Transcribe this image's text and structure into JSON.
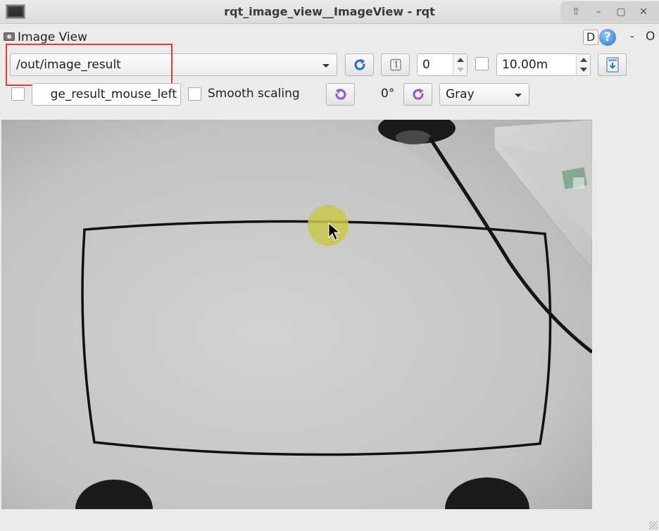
{
  "window": {
    "title": "rqt_image_view__ImageView - rqt",
    "controls": [
      "⇧",
      "–",
      "▢",
      "✕"
    ]
  },
  "plugin": {
    "title": "Image View",
    "d_label": "D",
    "help_label": "?",
    "min_label": "-",
    "close_label": "O"
  },
  "toolbar": {
    "topic": "/out/image_result",
    "spin_value": "0",
    "duration_value": "10.00m",
    "mouse_topic": "ge_result_mouse_left",
    "smooth_label": "Smooth scaling",
    "rotation_label": "0°",
    "color_scheme": "Gray"
  },
  "icons": {
    "refresh": "refresh-icon",
    "zoom": "zoom-1-icon",
    "save": "save-icon",
    "rotate_left": "rotate-left-icon",
    "rotate_right": "rotate-right-icon"
  },
  "colors": {
    "highlight": "#e23b3b",
    "refresh_blue": "#2e73c8",
    "rotate_purple": "#9b5cc8"
  }
}
